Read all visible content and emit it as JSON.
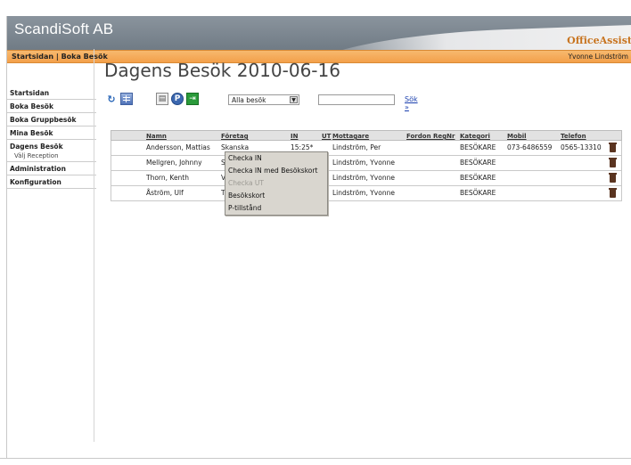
{
  "app": {
    "brand": "ScandiSoft AB",
    "product": "OfficeAssist"
  },
  "crumbs": {
    "path": "Startsidan | Boka Besök",
    "user": "Yvonne Lindström"
  },
  "sidebar": {
    "items": [
      {
        "label": "Startsidan"
      },
      {
        "label": "Boka Besök"
      },
      {
        "label": "Boka Gruppbesök"
      },
      {
        "label": "Mina Besök"
      },
      {
        "label": "Dagens Besök",
        "sub": "Välj Reception"
      },
      {
        "label": "Administration"
      },
      {
        "label": "Konfiguration"
      }
    ]
  },
  "page": {
    "title": "Dagens Besök 2010-06-16"
  },
  "toolbar": {
    "icons": [
      "refresh-icon",
      "grid-icon",
      "print-icon",
      "parking-icon",
      "exit-icon"
    ],
    "filter_value": "Alla besök",
    "search_value": "",
    "search_label": "Sök »"
  },
  "table": {
    "columns": [
      "Namn",
      "Företag",
      "IN",
      "UT",
      "Mottagare",
      "Fordon RegNr",
      "Kategori",
      "Mobil",
      "Telefon"
    ],
    "rows": [
      {
        "namn": "Andersson, Mattias",
        "foretag": "Skanska",
        "in": "15:25*",
        "ut": "",
        "mottagare": "Lindström, Per",
        "regnr": "",
        "kategori": "BESÖKARE",
        "mobil": "073-6486559",
        "telefon": "0565-13310"
      },
      {
        "namn": "Mellgren, Johnny",
        "foretag": "S",
        "in": "",
        "ut": "",
        "mottagare": "Lindström, Yvonne",
        "regnr": "",
        "kategori": "BESÖKARE",
        "mobil": "",
        "telefon": ""
      },
      {
        "namn": "Thorn, Kenth",
        "foretag": "V",
        "in": "",
        "ut": "",
        "mottagare": "Lindström, Yvonne",
        "regnr": "",
        "kategori": "BESÖKARE",
        "mobil": "",
        "telefon": ""
      },
      {
        "namn": "Åström, Ulf",
        "foretag": "T",
        "in": "",
        "ut": "",
        "mottagare": "Lindström, Yvonne",
        "regnr": "",
        "kategori": "BESÖKARE",
        "mobil": "",
        "telefon": ""
      }
    ]
  },
  "context_menu": {
    "items": [
      {
        "label": "Checka IN",
        "enabled": true
      },
      {
        "label": "Checka IN med Besökskort",
        "enabled": true
      },
      {
        "label": "Checka UT",
        "enabled": false
      },
      {
        "label": "Besökskort",
        "enabled": true
      },
      {
        "label": "P-tillstånd",
        "enabled": true
      }
    ]
  },
  "colors": {
    "accent_orange": "#f3a04a",
    "banner_gray": "#7c8690",
    "link_blue": "#1a3fae"
  }
}
